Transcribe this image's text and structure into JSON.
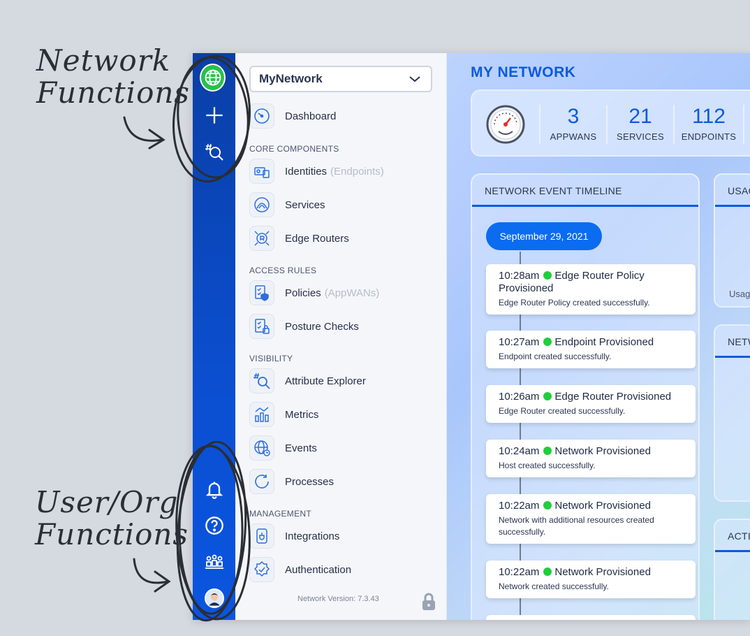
{
  "annotations": {
    "top": [
      "Network",
      "Functions"
    ],
    "bottom": [
      "User/Org",
      "Functions"
    ]
  },
  "rail": {
    "top_icons": [
      "globe-icon",
      "plus-icon",
      "attribute-search-icon"
    ],
    "bottom_icons": [
      "bell-icon",
      "help-icon",
      "organization-icon",
      "user-avatar-icon"
    ]
  },
  "sidebar": {
    "network_select": "MyNetwork",
    "items": [
      {
        "label": "Dashboard",
        "sub": "",
        "icon": "dashboard-gauge-icon"
      },
      {
        "label": "Identities",
        "sub": "(Endpoints)",
        "icon": "identities-icon"
      },
      {
        "label": "Services",
        "sub": "",
        "icon": "services-icon"
      },
      {
        "label": "Edge Routers",
        "sub": "",
        "icon": "edge-router-icon"
      },
      {
        "label": "Policies",
        "sub": "(AppWANs)",
        "icon": "policies-icon"
      },
      {
        "label": "Posture Checks",
        "sub": "",
        "icon": "posture-checks-icon"
      },
      {
        "label": "Attribute Explorer",
        "sub": "",
        "icon": "attribute-explorer-icon"
      },
      {
        "label": "Metrics",
        "sub": "",
        "icon": "metrics-icon"
      },
      {
        "label": "Events",
        "sub": "",
        "icon": "events-icon"
      },
      {
        "label": "Processes",
        "sub": "",
        "icon": "processes-icon"
      },
      {
        "label": "Integrations",
        "sub": "",
        "icon": "integrations-icon"
      },
      {
        "label": "Authentication",
        "sub": "",
        "icon": "authentication-icon"
      }
    ],
    "sections": {
      "core": "CORE COMPONENTS",
      "access": "ACCESS RULES",
      "visibility": "VISIBILITY",
      "management": "MANAGEMENT"
    },
    "version": "Network Version: 7.3.43"
  },
  "main": {
    "title": "MY NETWORK",
    "stats": [
      {
        "value": "3",
        "label": "APPWANS"
      },
      {
        "value": "21",
        "label": "SERVICES"
      },
      {
        "value": "112",
        "label": "ENDPOINTS"
      }
    ],
    "timeline": {
      "header": "NETWORK EVENT TIMELINE",
      "date": "September 29, 2021",
      "events": [
        {
          "time": "10:28am",
          "title": "Edge Router Policy Provisioned",
          "desc": "Edge Router Policy created successfully."
        },
        {
          "time": "10:27am",
          "title": "Endpoint Provisioned",
          "desc": "Endpoint created successfully."
        },
        {
          "time": "10:26am",
          "title": "Edge Router Provisioned",
          "desc": "Edge Router created successfully."
        },
        {
          "time": "10:24am",
          "title": "Network Provisioned",
          "desc": "Host created successfully."
        },
        {
          "time": "10:22am",
          "title": "Network Provisioned",
          "desc": "Network with additional resources created successfully."
        },
        {
          "time": "10:22am",
          "title": "Network Provisioned",
          "desc": "Network created successfully."
        }
      ]
    },
    "side_cards": [
      {
        "header": "USAG",
        "note": "Usag"
      },
      {
        "header": "NETW",
        "note": ""
      },
      {
        "header": "ACTI",
        "note": ""
      }
    ]
  },
  "colors": {
    "rail": "#0b4fd1",
    "accent": "#0b5bdc",
    "success_dot": "#1fcf3c",
    "globe": "#25c24a"
  }
}
